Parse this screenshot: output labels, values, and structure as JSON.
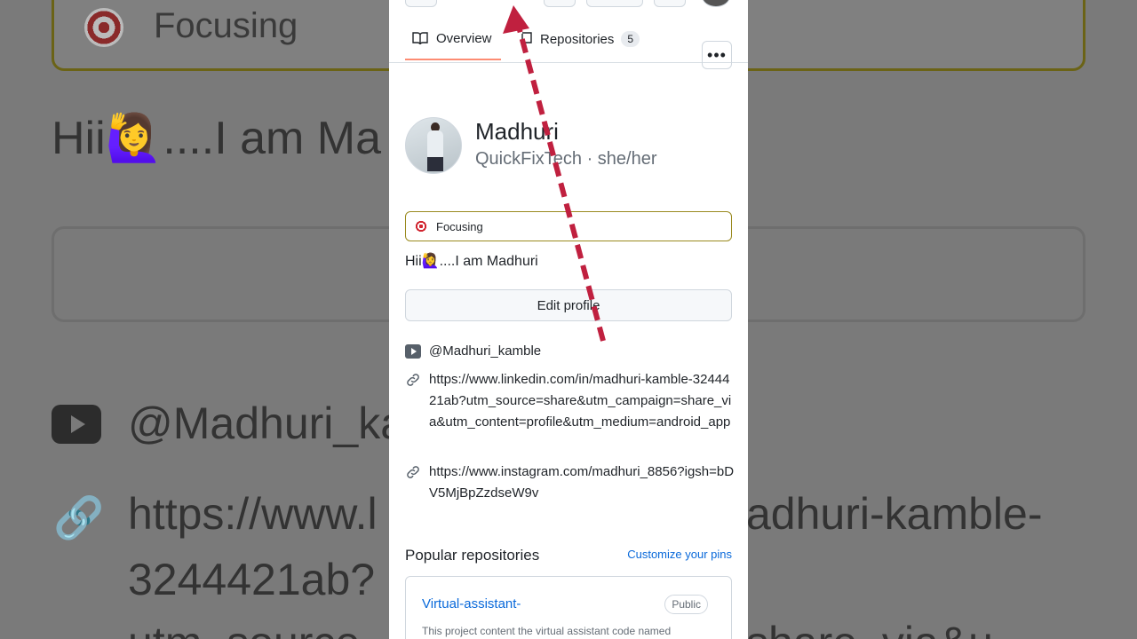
{
  "background": {
    "status": "Focusing",
    "bio": "Hii🙋‍♀️....I am Ma",
    "handle": "@Madhuri_ka",
    "link_part1": "https://www.l",
    "link_part2": "adhuri-kamble-",
    "link_line2": "3244421ab?",
    "link_line3a": "utm_source",
    "link_line3b": "share_via&u"
  },
  "tabs": {
    "overview": "Overview",
    "repositories": "Repositories",
    "repo_count": "5"
  },
  "profile": {
    "name": "Madhuri",
    "subtitle": "QuickFixTech · she/her",
    "status": "Focusing",
    "bio": "Hii🙋‍♀️....I am Madhuri",
    "edit_button": "Edit profile"
  },
  "links": {
    "youtube": "@Madhuri_kamble",
    "linkedin": "https://www.linkedin.com/in/madhuri-kamble-3244421ab?utm_source=share&utm_campaign=share_via&utm_content=profile&utm_medium=android_app",
    "instagram": "https://www.instagram.com/madhuri_8856?igsh=bDV5MjBpZzdseW9v"
  },
  "popular": {
    "title": "Popular repositories",
    "customize": "Customize your pins",
    "repo_name": "Virtual-assistant-",
    "visibility": "Public",
    "description": "This project content the virtual assistant code named"
  },
  "colors": {
    "arrow": "#c0203f",
    "link": "#0969da",
    "tab_underline": "#fd8c73",
    "status_border": "#9a8a1f"
  },
  "icons": [
    "book-icon",
    "repo-icon",
    "kebab-icon",
    "target-icon",
    "youtube-icon",
    "link-icon"
  ]
}
